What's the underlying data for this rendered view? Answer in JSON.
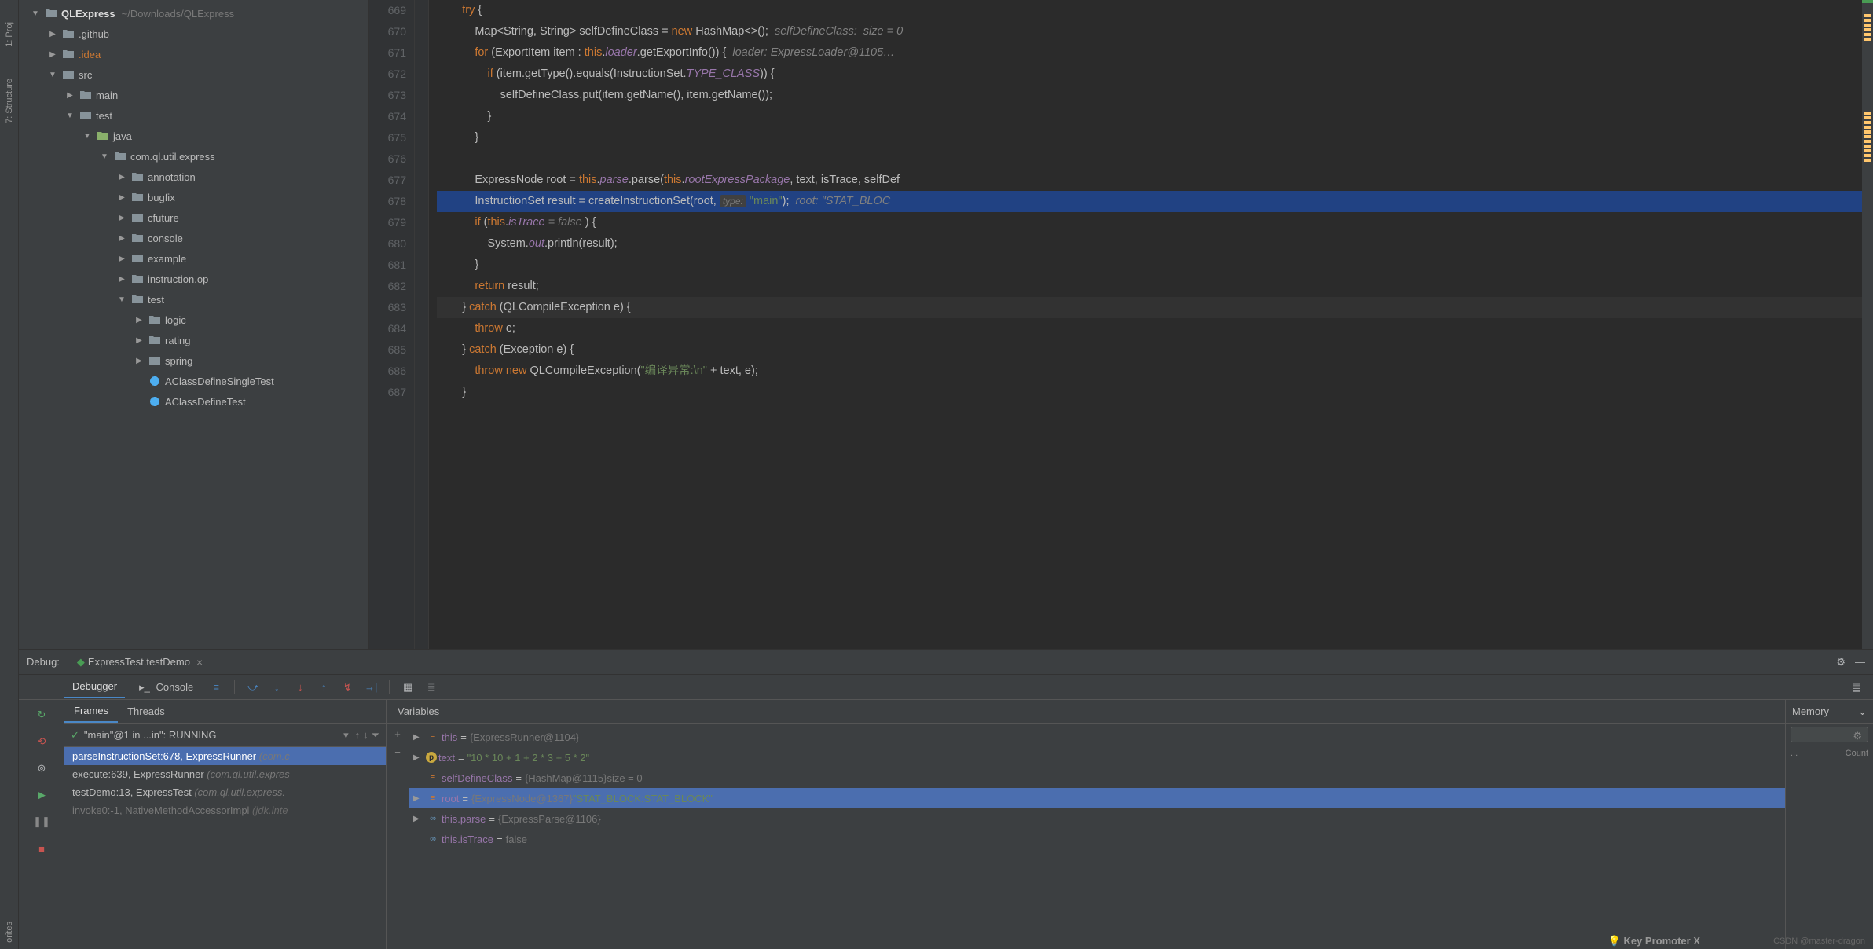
{
  "leftStrip": {
    "project": "1: Proj",
    "structure": "7: Structure",
    "favorites": "orites"
  },
  "tree": {
    "root": {
      "name": "QLExpress",
      "path": "~/Downloads/QLExpress"
    },
    "items": [
      {
        "indent": 1,
        "arrow": "▶",
        "icon": "folder",
        "label": ".github"
      },
      {
        "indent": 1,
        "arrow": "▶",
        "icon": "folder",
        "label": ".idea",
        "class": "orange"
      },
      {
        "indent": 1,
        "arrow": "▼",
        "icon": "folder",
        "label": "src"
      },
      {
        "indent": 2,
        "arrow": "▶",
        "icon": "folder",
        "label": "main"
      },
      {
        "indent": 2,
        "arrow": "▼",
        "icon": "folder",
        "label": "test"
      },
      {
        "indent": 3,
        "arrow": "▼",
        "icon": "folder-src",
        "label": "java"
      },
      {
        "indent": 4,
        "arrow": "▼",
        "icon": "folder",
        "label": "com.ql.util.express"
      },
      {
        "indent": 5,
        "arrow": "▶",
        "icon": "folder",
        "label": "annotation"
      },
      {
        "indent": 5,
        "arrow": "▶",
        "icon": "folder",
        "label": "bugfix"
      },
      {
        "indent": 5,
        "arrow": "▶",
        "icon": "folder",
        "label": "cfuture"
      },
      {
        "indent": 5,
        "arrow": "▶",
        "icon": "folder",
        "label": "console"
      },
      {
        "indent": 5,
        "arrow": "▶",
        "icon": "folder",
        "label": "example"
      },
      {
        "indent": 5,
        "arrow": "▶",
        "icon": "folder",
        "label": "instruction.op"
      },
      {
        "indent": 5,
        "arrow": "▼",
        "icon": "folder",
        "label": "test"
      },
      {
        "indent": 6,
        "arrow": "▶",
        "icon": "folder",
        "label": "logic"
      },
      {
        "indent": 6,
        "arrow": "▶",
        "icon": "folder",
        "label": "rating"
      },
      {
        "indent": 6,
        "arrow": "▶",
        "icon": "folder",
        "label": "spring"
      },
      {
        "indent": 6,
        "arrow": "",
        "icon": "test",
        "label": "AClassDefineSingleTest"
      },
      {
        "indent": 6,
        "arrow": "",
        "icon": "test",
        "label": "AClassDefineTest"
      }
    ]
  },
  "editor": {
    "lines": [
      {
        "n": 669,
        "html": "        <span class='kw'>try</span> {"
      },
      {
        "n": 670,
        "html": "            Map&lt;String, String&gt; selfDefineClass = <span class='kw'>new</span> HashMap&lt;&gt;();  <span class='comment'>selfDefineClass:  size = 0</span>"
      },
      {
        "n": 671,
        "html": "            <span class='kw'>for</span> (ExportItem item : <span class='kw'>this</span>.<span class='fld'>loader</span>.getExportInfo()) {  <span class='comment'>loader: ExpressLoader@1105…</span>"
      },
      {
        "n": 672,
        "html": "                <span class='kw'>if</span> (item.getType().equals(InstructionSet.<span class='fld'>TYPE_CLASS</span>)) {"
      },
      {
        "n": 673,
        "html": "                    selfDefineClass.put(item.getName(), item.getName());"
      },
      {
        "n": 674,
        "html": "                }"
      },
      {
        "n": 675,
        "html": "            }"
      },
      {
        "n": 676,
        "html": ""
      },
      {
        "n": 677,
        "html": "            ExpressNode root = <span class='kw'>this</span>.<span class='fld'>parse</span>.parse(<span class='kw'>this</span>.<span class='fld'>rootExpressPackage</span>, text, isTrace, selfDef"
      },
      {
        "n": 678,
        "highlighted": true,
        "html": "            InstructionSet result = createInstructionSet(root, <span class='param-hint'>type:</span> <span class='str'>\"main\"</span>);  <span class='comment'>root: \"STAT_BLOC</span>"
      },
      {
        "n": 679,
        "html": "            <span class='kw'>if</span> (<span class='kw'>this</span>.<span class='fld'>isTrace</span> <span class='inline-hint'>= false</span> ) {"
      },
      {
        "n": 680,
        "html": "                System.<span class='fld'>out</span>.println(result);"
      },
      {
        "n": 681,
        "html": "            }"
      },
      {
        "n": 682,
        "html": "            <span class='kw'>return</span> result;"
      },
      {
        "n": 683,
        "current": true,
        "html": "        } <span class='kw'>catch</span> (QLCompileException e) {"
      },
      {
        "n": 684,
        "html": "            <span class='kw'>throw</span> e;"
      },
      {
        "n": 685,
        "html": "        } <span class='kw'>catch</span> (Exception e) {"
      },
      {
        "n": 686,
        "html": "            <span class='kw'>throw</span> <span class='kw'>new</span> QLCompileException(<span class='str'>\"编译异常:\\n\"</span> + text, e);"
      },
      {
        "n": 687,
        "html": "        }"
      }
    ]
  },
  "debug": {
    "title": "Debug:",
    "tab": "ExpressTest.testDemo",
    "tabs": {
      "debugger": "Debugger",
      "console": "Console"
    },
    "frames": {
      "header": {
        "frames": "Frames",
        "threads": "Threads"
      },
      "thread": "\"main\"@1 in ...in\": RUNNING",
      "items": [
        {
          "text": "parseInstructionSet:678, ExpressRunner",
          "loc": "(com.c",
          "selected": true
        },
        {
          "text": "execute:639, ExpressRunner",
          "loc": "(com.ql.util.expres"
        },
        {
          "text": "testDemo:13, ExpressTest",
          "loc": "(com.ql.util.express."
        },
        {
          "text": "invoke0:-1, NativeMethodAccessorImpl",
          "loc": "(jdk.inte",
          "dim": true
        }
      ]
    },
    "vars": {
      "header": "Variables",
      "items": [
        {
          "arrow": "▶",
          "icon": "obj",
          "name": "this",
          "val": "{ExpressRunner@1104}"
        },
        {
          "arrow": "▶",
          "icon": "p",
          "name": "text",
          "str": "\"10 * 10 + 1 + 2 * 3 + 5 * 2\""
        },
        {
          "arrow": "",
          "icon": "obj",
          "name": "selfDefineClass",
          "val": "{HashMap@1115}",
          "extra": "  size = 0"
        },
        {
          "arrow": "▶",
          "icon": "obj",
          "name": "root",
          "val": "{ExpressNode@1367}",
          "str": " \"STAT_BLOCK:STAT_BLOCK\"",
          "selected": true
        },
        {
          "arrow": "▶",
          "icon": "inf",
          "name": "this.parse",
          "val": "{ExpressParse@1106}"
        },
        {
          "arrow": "",
          "icon": "inf",
          "name": "this.isTrace",
          "bool": "false"
        }
      ]
    },
    "memory": {
      "header": "Memory",
      "count": "Count",
      "diff": "..."
    }
  },
  "watermark": "CSDN @master-dragon",
  "keyPromoter": "Key Promoter X"
}
